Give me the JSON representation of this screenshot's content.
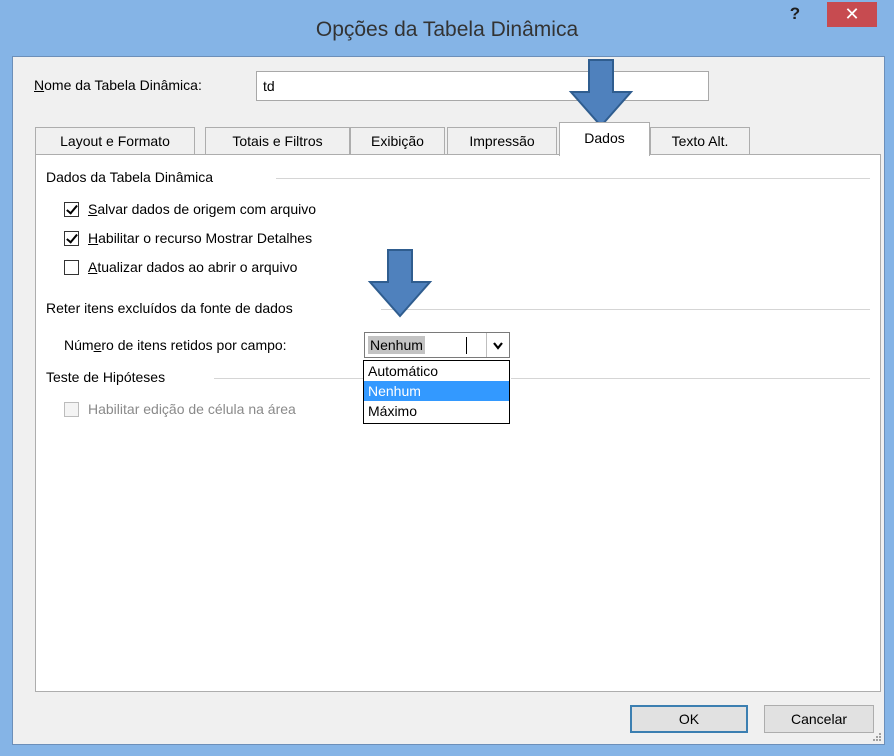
{
  "window": {
    "title": "Opções da Tabela Dinâmica",
    "help_label": "?",
    "close_label": "✕"
  },
  "name_field": {
    "label_accel": "N",
    "label_rest": "ome da Tabela Dinâmica:",
    "value": "td"
  },
  "tabs": [
    {
      "label": "Layout e Formato"
    },
    {
      "label": "Totais e Filtros"
    },
    {
      "label": "Exibição"
    },
    {
      "label": "Impressão"
    },
    {
      "label": "Dados"
    },
    {
      "label": "Texto Alt."
    }
  ],
  "active_tab": "Dados",
  "data_group": {
    "title": "Dados da Tabela Dinâmica",
    "save_source": {
      "accel": "S",
      "rest": "alvar dados de origem com arquivo",
      "checked": true
    },
    "show_details": {
      "accel": "H",
      "rest": "abilitar o recurso Mostrar Detalhes",
      "checked": true
    },
    "refresh_on_open": {
      "accel": "A",
      "rest": "tualizar dados ao abrir o arquivo",
      "checked": false
    }
  },
  "retain_group": {
    "title": "Reter itens excluídos da fonte de dados",
    "label_pre": "Núm",
    "label_accel": "e",
    "label_post": "ro de itens retidos por campo:",
    "selected": "Nenhum",
    "options": [
      "Automático",
      "Nenhum",
      "Máximo"
    ]
  },
  "whatif_group": {
    "title": "Teste de Hipóteses",
    "enable_edit": {
      "text": "Habilitar edição de célula na área",
      "checked": false,
      "disabled": true
    }
  },
  "buttons": {
    "ok": "OK",
    "cancel": "Cancelar"
  },
  "colors": {
    "annotation_arrow": "#4f81bd",
    "selection": "#3399ff",
    "close_button": "#c74b50"
  }
}
